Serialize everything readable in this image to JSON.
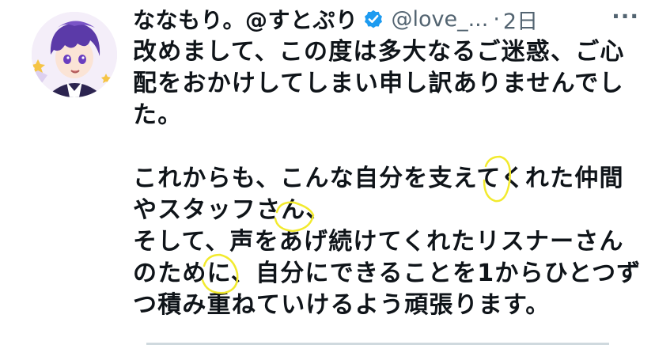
{
  "tweet": {
    "display_name": "ななもり。@すとぷり",
    "handle": "@love_...",
    "separator": "·",
    "time": "2日",
    "more_label": "···",
    "lines": [
      "改めまして、この度は多大なるご迷惑、ご心",
      "配をおかけしてしまい申し訳ありませんでし",
      "た。",
      "",
      "これからも、こんな自分を支えてくれた仲間",
      "やスタッフさん、",
      "そして、声をあげ続けてくれたリスナーさん",
      "のために、自分にできることを1からひとつず",
      "つ積み重ねていけるよう頑張ります。"
    ]
  },
  "colors": {
    "verified_badge": "#1d9bf0",
    "secondary_text": "#536471",
    "highlighter": "#f2ea2e",
    "avatar_hair": "#5b3aa8"
  },
  "icons": {
    "verified": "verified-badge-icon",
    "more": "more-icon"
  }
}
